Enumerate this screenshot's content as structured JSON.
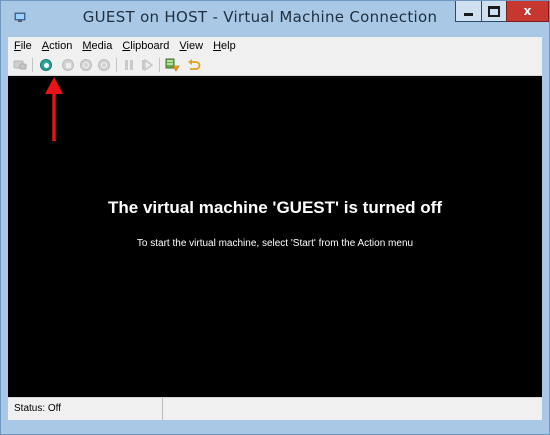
{
  "window": {
    "title": "GUEST on HOST - Virtual Machine Connection",
    "controls": {
      "close_glyph": "x"
    }
  },
  "menu": {
    "items": [
      {
        "key": "F",
        "rest": "ile"
      },
      {
        "key": "A",
        "rest": "ction"
      },
      {
        "key": "M",
        "rest": "edia"
      },
      {
        "key": "C",
        "rest": "lipboard"
      },
      {
        "key": "V",
        "rest": "iew"
      },
      {
        "key": "H",
        "rest": "elp"
      }
    ]
  },
  "toolbar": {
    "icons": [
      "ctrl-alt-del-icon",
      "start-icon",
      "turn-off-icon",
      "shut-down-icon",
      "save-icon",
      "pause-icon",
      "reset-icon",
      "checkpoint-icon",
      "revert-icon"
    ]
  },
  "screen": {
    "title": "The virtual machine 'GUEST' is turned off",
    "subtitle": "To start the virtual machine, select 'Start' from the Action menu"
  },
  "status": {
    "text": "Status: Off"
  },
  "colors": {
    "title_bar": "#a9c8e6",
    "close_button": "#c7372f",
    "start_icon": "#2aa59a",
    "annotation_arrow": "#e8141a"
  }
}
